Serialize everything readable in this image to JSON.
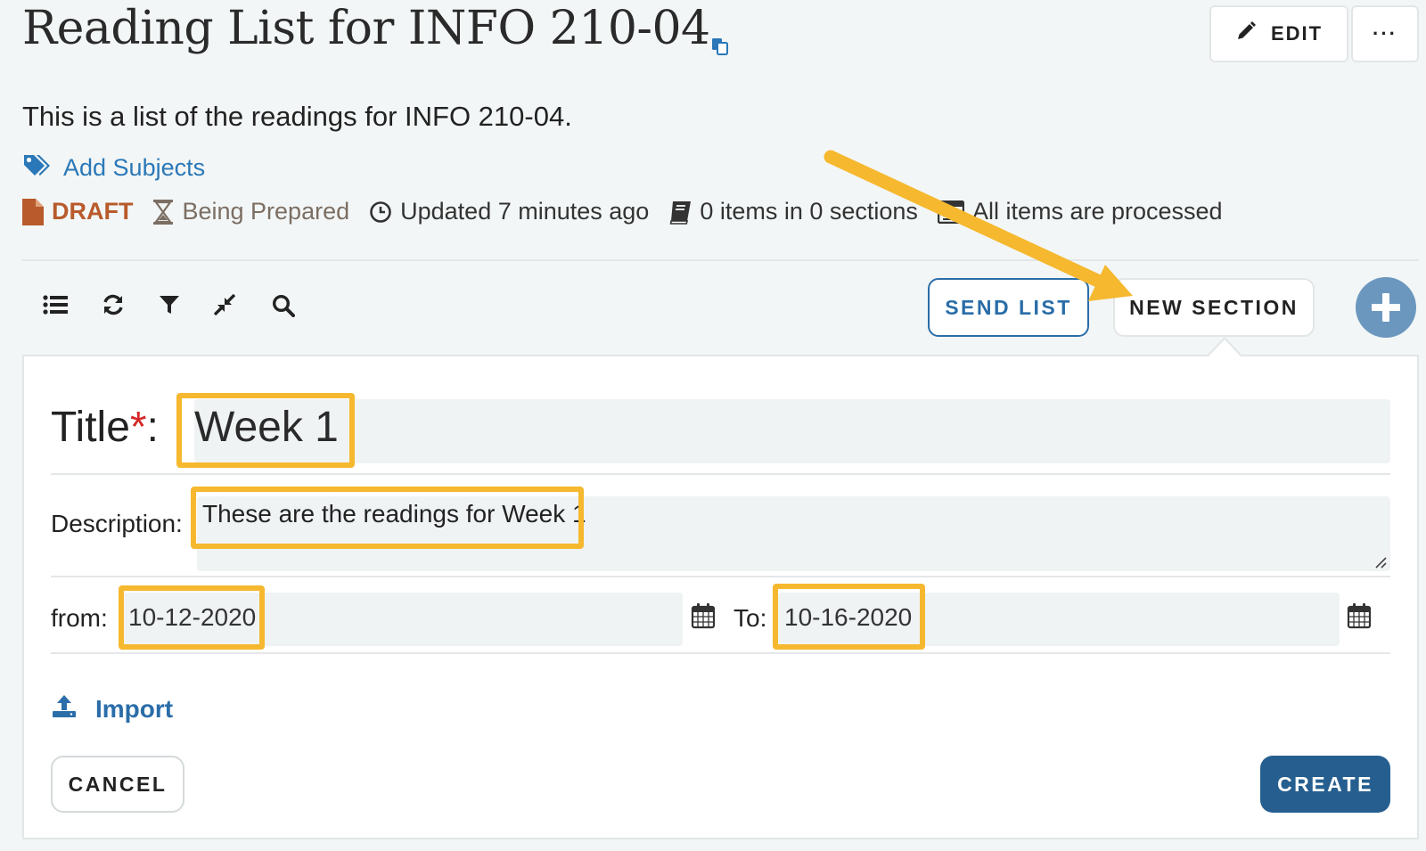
{
  "header": {
    "title": "Reading List for INFO 210-04",
    "edit_label": "EDIT",
    "more_label": "···"
  },
  "list": {
    "description": "This is a list of the readings for INFO 210-04.",
    "add_subjects_label": "Add Subjects"
  },
  "meta": {
    "status": "DRAFT",
    "state": "Being Prepared",
    "updated": "Updated 7 minutes ago",
    "items": "0 items in 0 sections",
    "processed": "All items are processed"
  },
  "toolbar": {
    "icons": [
      "list-icon",
      "refresh-icon",
      "filter-icon",
      "collapse-icon",
      "search-icon"
    ],
    "send_list_label": "SEND LIST",
    "new_section_label": "NEW SECTION"
  },
  "form": {
    "title_label": "Title",
    "required_mark": "*",
    "title_colon": ":",
    "title_value": "Week 1",
    "description_label": "Description:",
    "description_value": "These are the readings for Week 1",
    "from_label": "from:",
    "from_value": "10-12-2020",
    "to_label": "To:",
    "to_value": "10-16-2020",
    "import_label": "Import",
    "cancel_label": "CANCEL",
    "create_label": "CREATE"
  },
  "colors": {
    "accent": "#2a6da8",
    "draft": "#b85a2c",
    "highlight": "#f5b82e",
    "create_bg": "#265f8f"
  }
}
